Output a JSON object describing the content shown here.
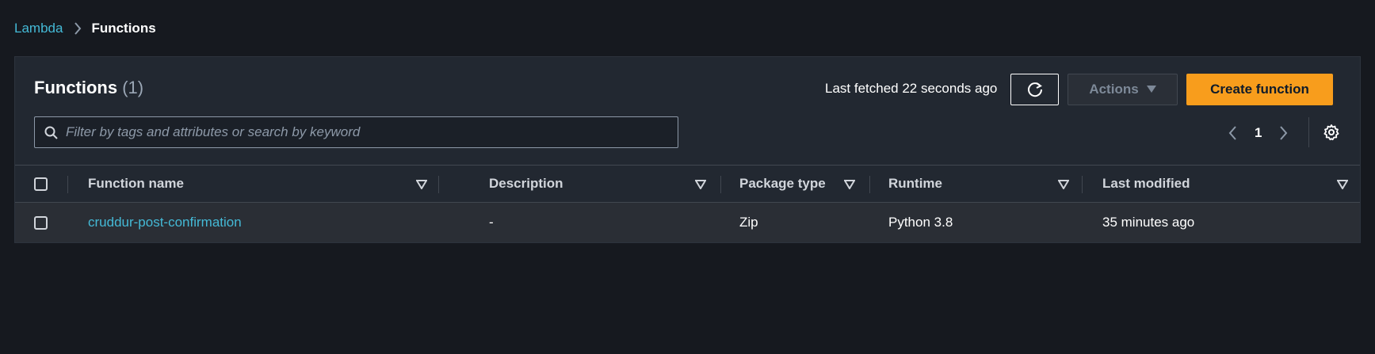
{
  "breadcrumb": {
    "parent": "Lambda",
    "current": "Functions"
  },
  "panel": {
    "title": "Functions",
    "count": "(1)",
    "last_fetched": "Last fetched 22 seconds ago",
    "actions_label": "Actions",
    "create_label": "Create function",
    "refresh_icon": "refresh-icon"
  },
  "search": {
    "placeholder": "Filter by tags and attributes or search by keyword",
    "value": ""
  },
  "pagination": {
    "current_page": "1"
  },
  "table": {
    "headers": [
      "Function name",
      "Description",
      "Package type",
      "Runtime",
      "Last modified"
    ],
    "rows": [
      {
        "name": "cruddur-post-confirmation",
        "description": "-",
        "package_type": "Zip",
        "runtime": "Python 3.8",
        "last_modified": "35 minutes ago"
      }
    ]
  },
  "colors": {
    "accent": "#f89d1c",
    "link": "#44b9d6",
    "background": "#16191f",
    "panel": "#222831"
  }
}
